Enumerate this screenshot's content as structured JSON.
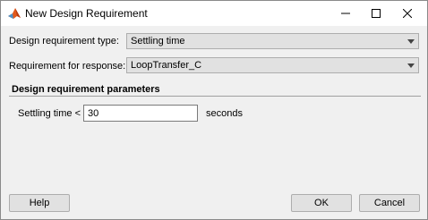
{
  "window": {
    "title": "New Design Requirement"
  },
  "form": {
    "type_label": "Design requirement type:",
    "type_value": "Settling time",
    "response_label": "Requirement for response:",
    "response_value": "LoopTransfer_C"
  },
  "parameters": {
    "section_title": "Design requirement parameters",
    "settling_label": "Settling time <",
    "settling_value": "30",
    "unit": "seconds"
  },
  "buttons": {
    "help": "Help",
    "ok": "OK",
    "cancel": "Cancel"
  },
  "icons": {
    "app": "matlab-icon",
    "minimize": "minimize-icon",
    "maximize": "maximize-icon",
    "close": "close-icon",
    "dropdown": "chevron-down-icon"
  }
}
